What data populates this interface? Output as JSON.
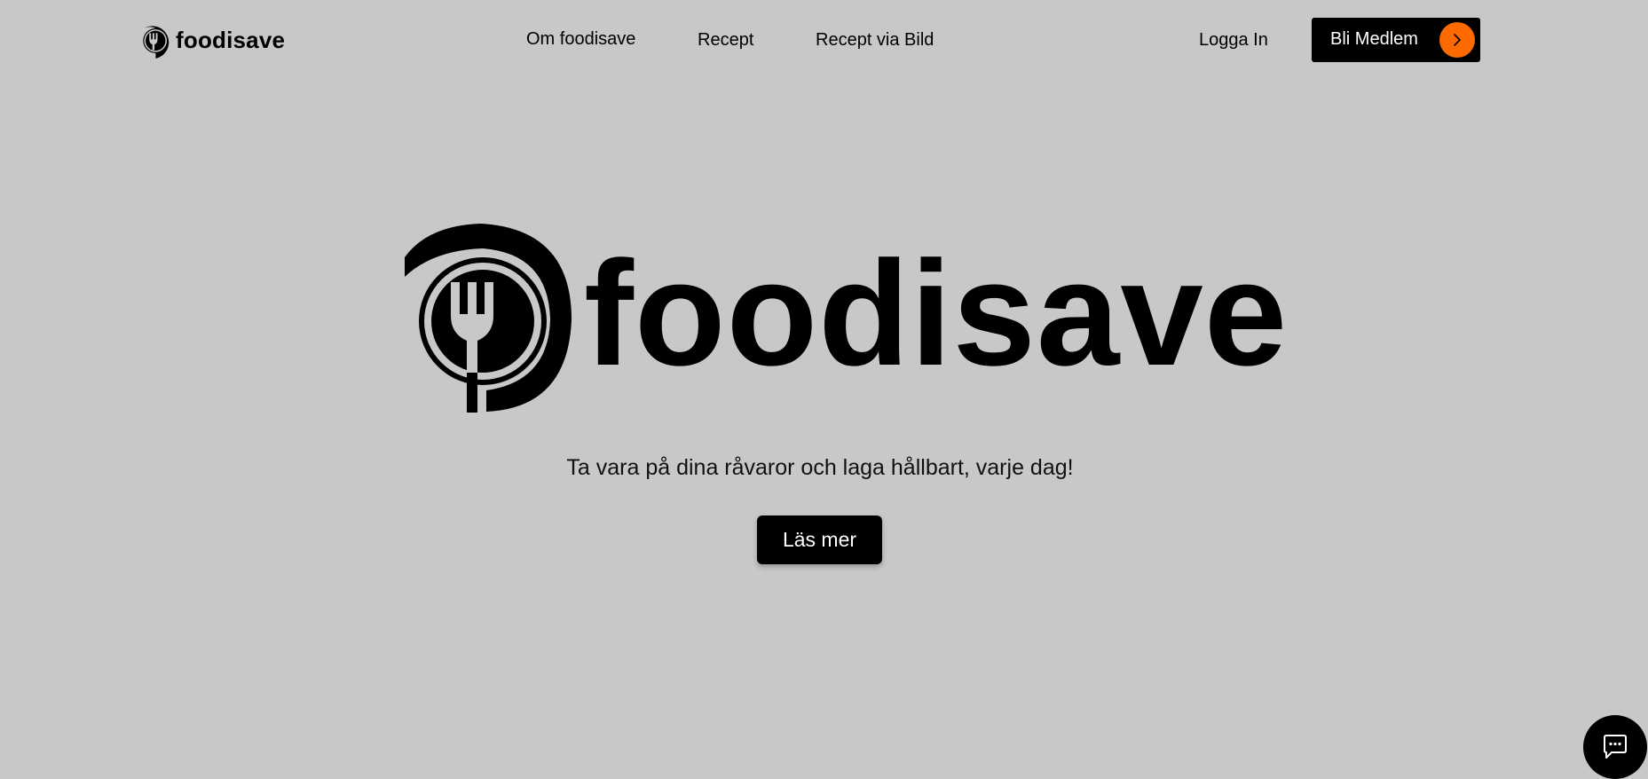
{
  "header": {
    "brand": {
      "name": "foodisave",
      "icon": "fork-plate-logo-icon"
    },
    "nav": [
      {
        "label": "Om foodisave"
      },
      {
        "label": "Recept"
      },
      {
        "label": "Recept via Bild"
      }
    ],
    "login_label": "Logga In",
    "join": {
      "label": "Bli Medlem",
      "icon": "chevron-right-icon",
      "accent_color": "#ff6a00"
    }
  },
  "hero": {
    "logo_text": "foodisave",
    "logo_icon": "fork-plate-logo-icon",
    "tagline": "Ta vara på dina råvaror och laga hållbart, varje dag!",
    "cta_label": "Läs mer"
  },
  "chat": {
    "icon": "chat-bubble-icon"
  },
  "colors": {
    "background": "#c8c8c8",
    "primary": "#000000",
    "accent": "#ff6a00",
    "button_text": "#ffffff"
  }
}
